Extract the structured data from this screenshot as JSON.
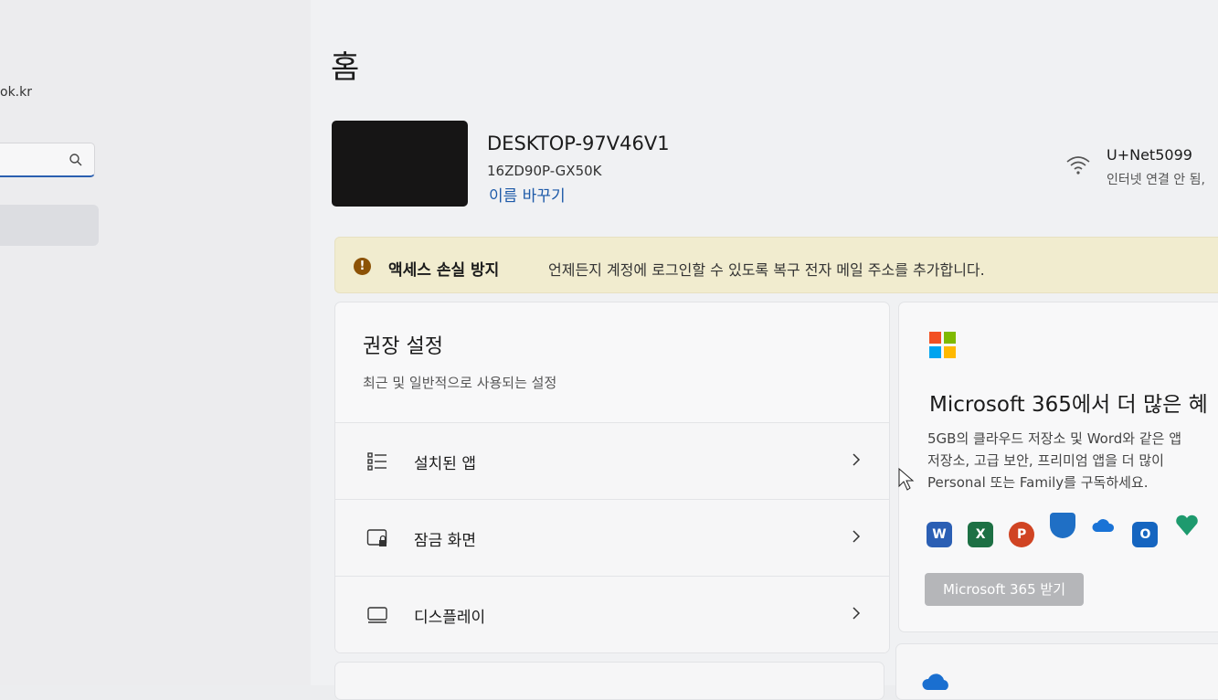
{
  "sidebar": {
    "account_email_fragment": "ok.kr",
    "search_placeholder": "",
    "search_icon": "search-icon"
  },
  "page": {
    "title": "홈"
  },
  "device": {
    "name": "DESKTOP-97V46V1",
    "model": "16ZD90P-GX50K",
    "rename_label": "이름 바꾸기"
  },
  "network": {
    "icon": "wifi-icon",
    "name": "U+Net5099",
    "status": "인터넷 연결 안 됨,"
  },
  "banner": {
    "icon": "warning-icon",
    "title": "액세스 손실 방지",
    "text": "언제든지 계정에 로그인할 수 있도록 복구 전자 메일 주소를 추가합니다."
  },
  "recommended": {
    "title": "권장 설정",
    "subtitle": "최근 및 일반적으로 사용되는 설정",
    "items": [
      {
        "label": "설치된 앱",
        "icon": "list-icon"
      },
      {
        "label": "잠금 화면",
        "icon": "lock-screen-icon"
      },
      {
        "label": "디스플레이",
        "icon": "display-icon"
      }
    ]
  },
  "microsoft365": {
    "title": "Microsoft 365에서 더 많은 혜",
    "body": "5GB의 클라우드 저장소 및 Word와 같은 앱\n저장소, 고급 보안, 프리미엄 앱을 더 많이 \nPersonal 또는 Family를 구독하세요.",
    "button_label": "Microsoft 365 받기",
    "apps": [
      "word-icon",
      "excel-icon",
      "powerpoint-icon",
      "defender-icon",
      "onedrive-icon",
      "outlook-icon",
      "family-safety-icon"
    ],
    "colors": {
      "logo_red": "#f25022",
      "logo_green": "#7fba00",
      "logo_blue": "#00a4ef",
      "logo_yellow": "#ffb900"
    }
  }
}
